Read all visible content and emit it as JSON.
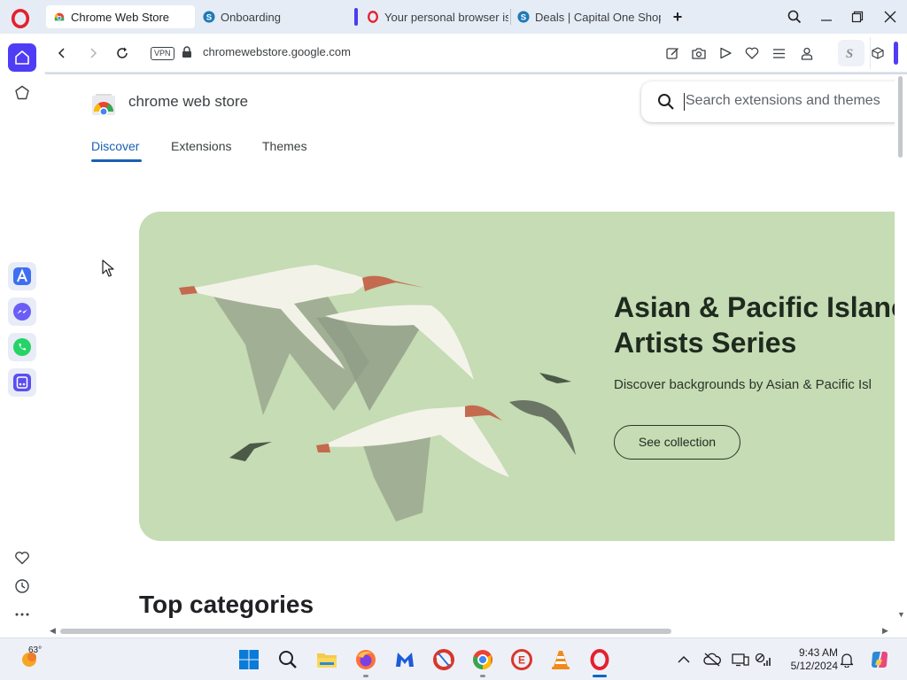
{
  "tabs": [
    {
      "label": "Chrome Web Store",
      "active": true
    },
    {
      "label": "Onboarding",
      "active": false
    },
    {
      "label": "Your personal browser is a",
      "active": false
    },
    {
      "label": "Deals | Capital One Shopp",
      "active": false
    }
  ],
  "address": {
    "vpn_label": "VPN",
    "url": "chromewebstore.google.com"
  },
  "store": {
    "title": "chrome web store",
    "search_placeholder": "Search extensions and themes",
    "nav": [
      "Discover",
      "Extensions",
      "Themes"
    ],
    "active_nav": "Discover"
  },
  "hero": {
    "title_line1": "Asian & Pacific Islanc",
    "title_line2": "Artists Series",
    "description": "Discover backgrounds by Asian & Pacific Isl",
    "button": "See collection",
    "background_color": "#c5dcb4"
  },
  "section": {
    "top_categories": "Top categories"
  },
  "taskbar": {
    "temperature": "63°",
    "time": "9:43 AM",
    "date": "5/12/2024"
  },
  "colors": {
    "opera_red": "#e5202e",
    "accent_purple": "#4f3df5",
    "link_blue": "#1a5fb4"
  }
}
